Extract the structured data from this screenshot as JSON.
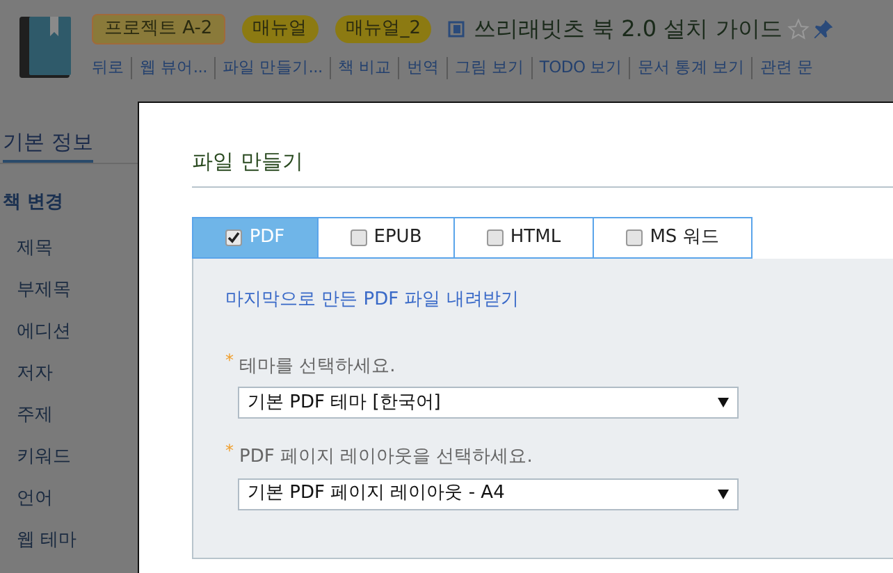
{
  "header": {
    "tags": [
      {
        "label": "프로젝트 A-2",
        "kind": "project"
      },
      {
        "label": "매뉴얼",
        "kind": "pill"
      },
      {
        "label": "매뉴얼_2",
        "kind": "pill"
      }
    ],
    "title": "쓰리래빗츠 북 2.0 설치 가이드",
    "starred": false,
    "nav": [
      "뒤로",
      "웹 뷰어...",
      "파일 만들기...",
      "책 비교",
      "번역",
      "그림 보기",
      "TODO 보기",
      "문서 통계 보기",
      "관련 문"
    ]
  },
  "sidebar": {
    "heading": "기본 정보",
    "section": "책 변경",
    "items": [
      "제목",
      "부제목",
      "에디션",
      "저자",
      "주제",
      "키워드",
      "언어",
      "웹 테마"
    ]
  },
  "dialog": {
    "title": "파일 만들기",
    "tabs": [
      {
        "label": "PDF",
        "selected": true,
        "checked": true
      },
      {
        "label": "EPUB",
        "selected": false,
        "checked": false
      },
      {
        "label": "HTML",
        "selected": false,
        "checked": false
      },
      {
        "label": "MS 워드",
        "selected": false,
        "checked": false
      }
    ],
    "download_link": "마지막으로 만든 PDF 파일 내려받기",
    "fields": [
      {
        "label": "테마를 선택하세요.",
        "marker": "*",
        "value": "기본 PDF 테마 [한국어]"
      },
      {
        "label": "PDF 페이지 레이아웃을 선택하세요.",
        "marker": "*",
        "value": "기본 PDF 페이지 레이아웃 - A4"
      }
    ]
  }
}
